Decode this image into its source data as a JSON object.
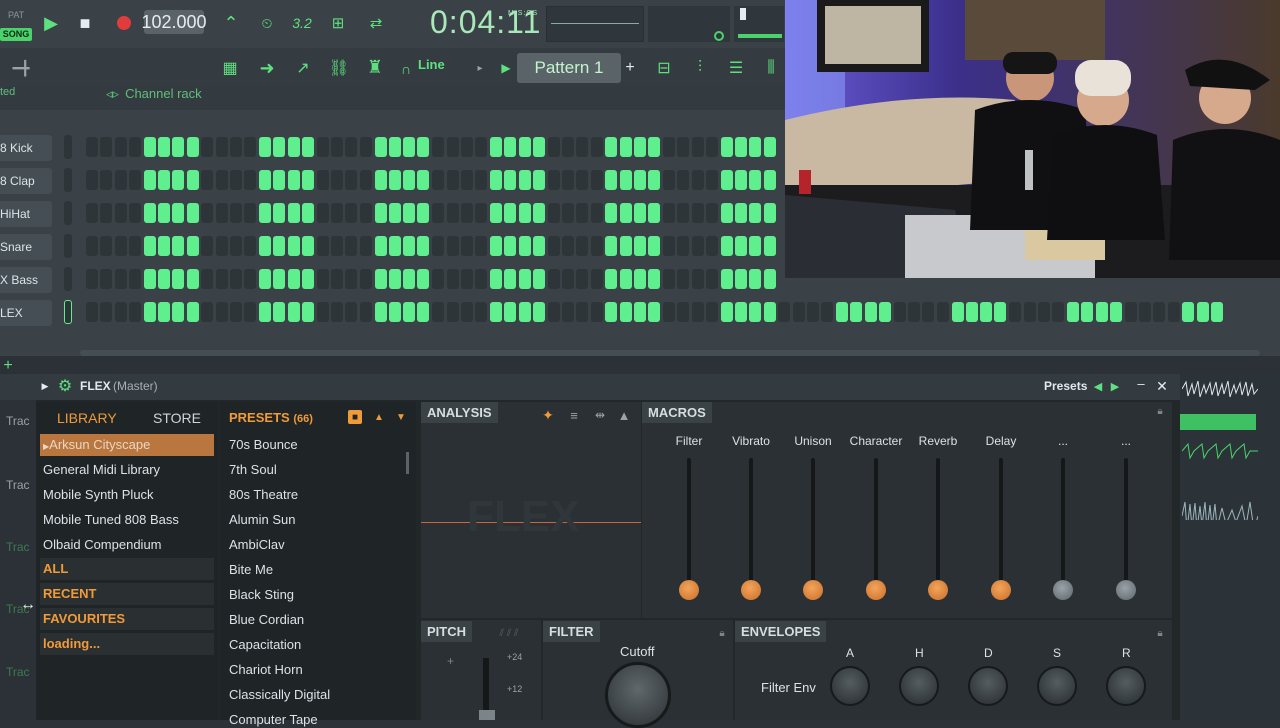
{
  "toolbar": {
    "pat_label": "PAT",
    "song_label": "SONG",
    "tempo": "102.000",
    "time": "0:04:11",
    "time_unit": "M:S:CS",
    "snap_mode": "Line",
    "pattern": "Pattern 1"
  },
  "rack": {
    "header_left": "ted",
    "title": "Channel rack",
    "channels": [
      {
        "name": "8 Kick"
      },
      {
        "name": "8 Clap"
      },
      {
        "name": "HiHat"
      },
      {
        "name": "Snare"
      },
      {
        "name": "X Bass"
      },
      {
        "name": "LEX"
      }
    ]
  },
  "flex": {
    "title": "FLEX",
    "subtitle": "(Master)",
    "presets_label": "Presets",
    "library_tab": "LIBRARY",
    "store_tab": "STORE",
    "presets_header": "PRESETS",
    "presets_count": "(66)",
    "library_selected": "Arksun Cityscape",
    "library_items": [
      "General Midi Library",
      "Mobile Synth Pluck",
      "Mobile Tuned 808 Bass",
      "Olbaid Compendium"
    ],
    "categories": [
      "ALL",
      "RECENT",
      "FAVOURITES",
      "loading..."
    ],
    "presets": [
      "70s Bounce",
      "7th Soul",
      "80s Theatre",
      "Alumin Sun",
      "AmbiClav",
      "Bite Me",
      "Black Sting",
      "Blue Cordian",
      "Capacitation",
      "Chariot Horn",
      "Classically Digital",
      "Computer Tape"
    ],
    "analysis_title": "ANALYSIS",
    "macros_title": "MACROS",
    "macros": [
      {
        "label": "Filter",
        "level": 0.0,
        "active": true
      },
      {
        "label": "Vibrato",
        "level": 0.0,
        "active": true
      },
      {
        "label": "Unison",
        "level": 0.0,
        "active": true
      },
      {
        "label": "Character",
        "level": 0.0,
        "active": true
      },
      {
        "label": "Reverb",
        "level": 0.0,
        "active": true
      },
      {
        "label": "Delay",
        "level": 0.0,
        "active": true
      },
      {
        "label": "...",
        "level": 0.0,
        "active": false
      },
      {
        "label": "...",
        "level": 0.0,
        "active": false
      }
    ],
    "pitch_title": "PITCH",
    "pitch_marks": [
      "+24",
      "+12"
    ],
    "filter_title": "FILTER",
    "cutoff_label": "Cutoff",
    "envelopes_title": "ENVELOPES",
    "env_row_label": "Filter Env",
    "env_labels": [
      "A",
      "H",
      "D",
      "S",
      "R"
    ]
  },
  "left_tracks": [
    "Trac",
    "Trac",
    "Trac",
    "Trac",
    "Trac"
  ],
  "colors": {
    "accent": "#5fef8f",
    "orange": "#f09a3a",
    "knob_orange": "#e08a3a"
  }
}
